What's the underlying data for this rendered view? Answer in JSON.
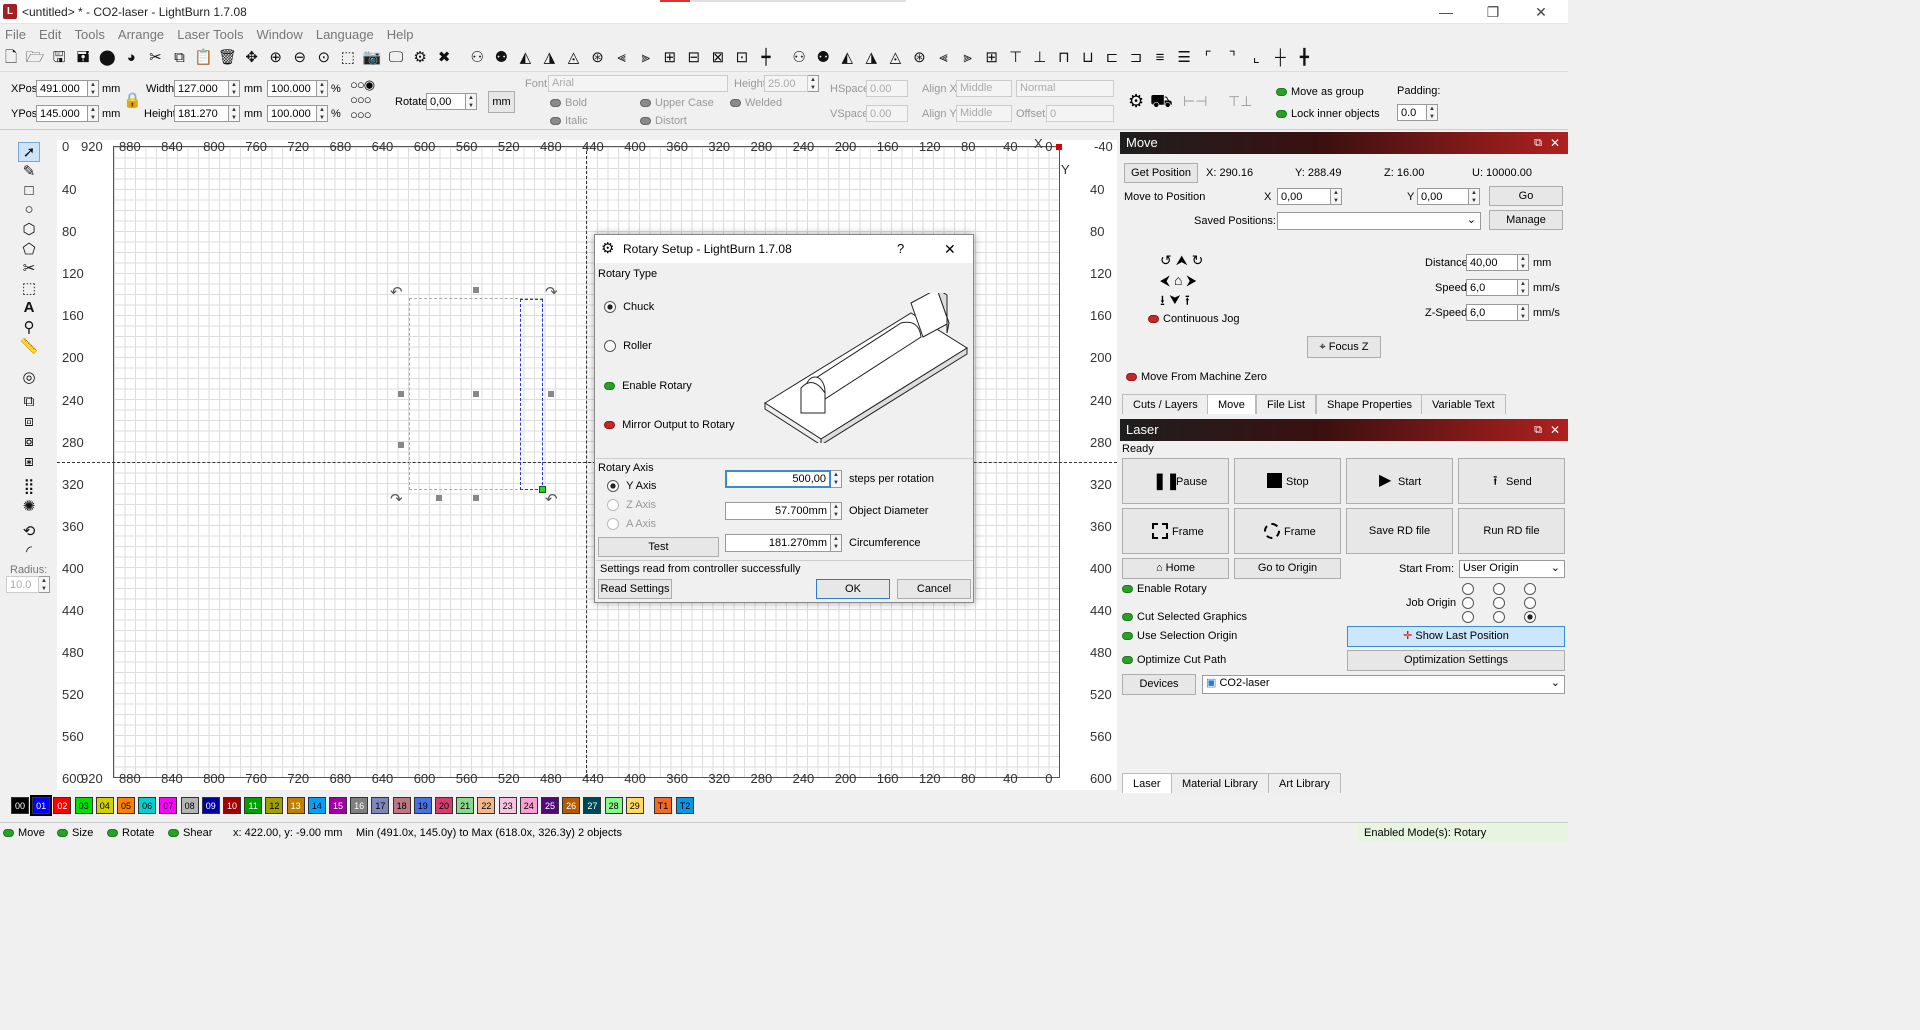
{
  "window": {
    "title": "<untitled> * - CO2-laser - LightBurn 1.7.08",
    "minimize": "—",
    "maximize": "❐",
    "close": "✕"
  },
  "menu": [
    "File",
    "Edit",
    "Tools",
    "Arrange",
    "Laser Tools",
    "Window",
    "Language",
    "Help"
  ],
  "toolbar2": {
    "xpos_label": "XPos",
    "xpos": "491.000",
    "ypos_label": "YPos",
    "ypos": "145.000",
    "mm": "mm",
    "width_label": "Width",
    "width": "127.000",
    "height_label": "Height",
    "height": "181.270",
    "pct_w": "100.000",
    "pct_h": "100.000",
    "pct": "%",
    "rotate_label": "Rotate",
    "rotate": "0,00",
    "unit_btn": "mm",
    "font_label": "Font",
    "font": "Arial",
    "fheight_label": "Height",
    "fheight": "25.00",
    "hspace_label": "HSpace",
    "hspace": "0.00",
    "vspace_label": "VSpace",
    "vspace": "0.00",
    "alignx_label": "Align X",
    "alignx": "Middle",
    "aligny_label": "Align Y",
    "aligny": "Middle",
    "style": "Normal",
    "offset_label": "Offset",
    "offset": "0",
    "bold": "Bold",
    "italic": "Italic",
    "upper": "Upper Case",
    "distort": "Distort",
    "welded": "Welded",
    "move_group": "Move as group",
    "lock_inner": "Lock inner objects",
    "padding_label": "Padding:",
    "padding": "0.0"
  },
  "ruler": {
    "top": [
      "880",
      "840",
      "800",
      "760",
      "720",
      "680",
      "640",
      "600",
      "560",
      "520",
      "480",
      "440",
      "400",
      "360",
      "320",
      "280",
      "240",
      "200",
      "160",
      "120",
      "80",
      "40",
      "0"
    ],
    "top_right": "-40",
    "left": [
      "40",
      "80",
      "120",
      "160",
      "200",
      "240",
      "280",
      "320",
      "360",
      "400",
      "440",
      "480",
      "520",
      "560"
    ],
    "corner_top": "920",
    "corner_bottom": "920",
    "origin": "0",
    "y_bottom": "600",
    "bottom_right": "600",
    "right_top": "-40",
    "x_marker": "X",
    "y_marker": "Y"
  },
  "radius": {
    "label": "Radius:",
    "value": "10.0"
  },
  "palette": [
    "00",
    "01",
    "02",
    "03",
    "04",
    "05",
    "06",
    "07",
    "08",
    "09",
    "10",
    "11",
    "12",
    "13",
    "14",
    "15",
    "16",
    "17",
    "18",
    "19",
    "20",
    "21",
    "22",
    "23",
    "24",
    "25",
    "26",
    "27",
    "28",
    "29",
    "T1",
    "T2"
  ],
  "palette_colors": [
    "#000000",
    "#0000ff",
    "#ff0000",
    "#00e000",
    "#d0d000",
    "#ff8000",
    "#00d0d0",
    "#ff00ff",
    "#b4b4b4",
    "#0000a0",
    "#a00000",
    "#00a000",
    "#a0a000",
    "#c08000",
    "#00a0ff",
    "#a000a0",
    "#808080",
    "#7d87b9",
    "#bb7784",
    "#4a6fe3",
    "#d33f6a",
    "#8cd78c",
    "#f0b98d",
    "#f6c4e1",
    "#fa9ed4",
    "#500a78",
    "#b45a00",
    "#004754",
    "#86fa88",
    "#ffdb66",
    "#f36926",
    "#0c95e0"
  ],
  "status": {
    "move": "Move",
    "size": "Size",
    "rotate": "Rotate",
    "shear": "Shear",
    "coords": "x: 422.00, y: -9.00 mm",
    "sel": "Min (491.0x, 145.0y) to Max (618.0x, 326.3y)  2 objects",
    "mode": "Enabled Mode(s): Rotary"
  },
  "move_panel": {
    "title": "Move",
    "get_position": "Get Position",
    "x": "X: 290.16",
    "y": "Y: 288.49",
    "z": "Z: 16.00",
    "u": "U: 10000.00",
    "move_to": "Move to Position",
    "x_label": "X",
    "x_val": "0,00",
    "y_label": "Y",
    "y_val": "0,00",
    "go": "Go",
    "saved": "Saved Positions:",
    "manage": "Manage",
    "distance_label": "Distance",
    "distance": "40,00",
    "speed_label": "Speed",
    "speed": "6,0",
    "zspeed_label": "Z-Speed",
    "zspeed": "6,0",
    "mm": "mm",
    "mms": "mm/s",
    "continuous": "Continuous Jog",
    "focus": "Focus Z",
    "from_zero": "Move From Machine Zero"
  },
  "tabs1": [
    "Cuts / Layers",
    "Move",
    "File List",
    "Shape Properties",
    "Variable Text"
  ],
  "laser_panel": {
    "title": "Laser",
    "state": "Ready",
    "pause": "Pause",
    "stop": "Stop",
    "start": "Start",
    "send": "Send",
    "frame1": "Frame",
    "frame2": "Frame",
    "save_rd": "Save RD file",
    "run_rd": "Run RD file",
    "home": "Home",
    "goto_origin": "Go to Origin",
    "start_from_label": "Start From:",
    "start_from": "User Origin",
    "enable_rotary": "Enable Rotary",
    "job_origin": "Job Origin",
    "cut_selected": "Cut Selected Graphics",
    "use_sel": "Use Selection Origin",
    "show_last": "Show Last Position",
    "optimize": "Optimize Cut Path",
    "opt_settings": "Optimization Settings",
    "devices": "Devices",
    "device": "CO2-laser"
  },
  "tabs2": [
    "Laser",
    "Material Library",
    "Art Library"
  ],
  "dialog": {
    "title": "Rotary Setup - LightBurn 1.7.08",
    "help": "?",
    "close": "✕",
    "rotary_type": "Rotary Type",
    "chuck": "Chuck",
    "roller": "Roller",
    "enable": "Enable Rotary",
    "mirror": "Mirror Output to Rotary",
    "rotary_axis": "Rotary Axis",
    "y_axis": "Y Axis",
    "z_axis": "Z Axis",
    "a_axis": "A Axis",
    "test": "Test",
    "steps": "500,00",
    "steps_label": "steps per rotation",
    "diameter": "57.700mm",
    "diameter_label": "Object Diameter",
    "circ": "181.270mm",
    "circ_label": "Circumference",
    "message": "Settings read from controller successfully",
    "read": "Read Settings",
    "ok": "OK",
    "cancel": "Cancel"
  }
}
